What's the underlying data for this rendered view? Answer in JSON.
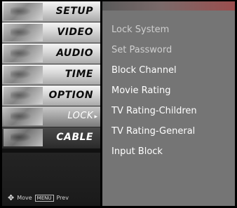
{
  "menu": {
    "items": [
      {
        "label": "SETUP",
        "icon": "setup-icon"
      },
      {
        "label": "VIDEO",
        "icon": "video-icon"
      },
      {
        "label": "AUDIO",
        "icon": "audio-icon"
      },
      {
        "label": "TIME",
        "icon": "time-icon"
      },
      {
        "label": "OPTION",
        "icon": "option-icon"
      },
      {
        "label": "LOCK",
        "icon": "lock-icon",
        "selected": true
      },
      {
        "label": "CABLE",
        "icon": "cable-icon"
      }
    ],
    "selected_arrow": "▸",
    "footer": {
      "move_label": "Move",
      "menu_key_label": "MENU",
      "prev_label": "Prev"
    }
  },
  "lock_menu": {
    "options": [
      {
        "label": "Lock System",
        "enabled": false
      },
      {
        "label": "Set Password",
        "enabled": false
      },
      {
        "label": "Block Channel",
        "enabled": true
      },
      {
        "label": "Movie Rating",
        "enabled": true
      },
      {
        "label": "TV Rating-Children",
        "enabled": true
      },
      {
        "label": "TV Rating-General",
        "enabled": true
      },
      {
        "label": "Input Block",
        "enabled": true
      }
    ]
  },
  "colors": {
    "panel_bg": "#757575",
    "enabled_text": "#ffffff",
    "disabled_text": "#cfcfcf",
    "selected_accent": "#9b4d4d"
  }
}
